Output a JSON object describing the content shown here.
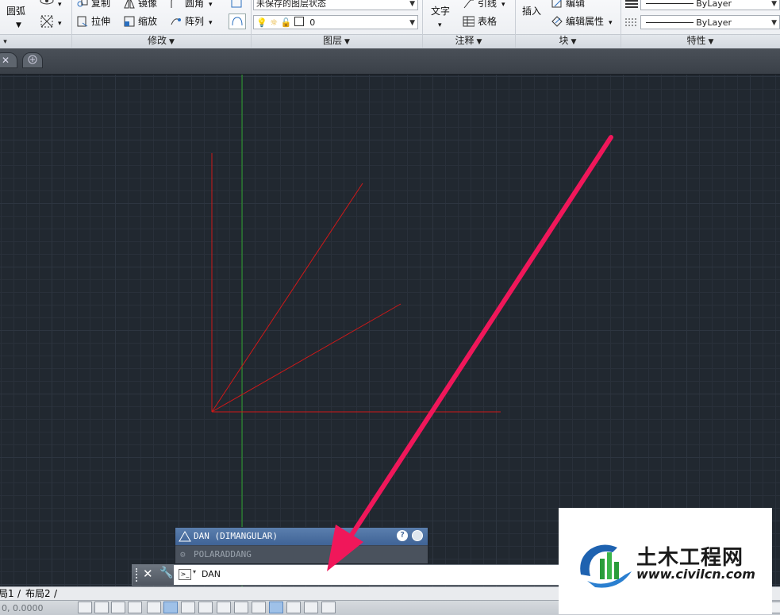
{
  "ribbon": {
    "draw": {
      "arc_label": "圆弧"
    },
    "modify": {
      "copy": "复制",
      "mirror": "镜像",
      "fillet": "圆角",
      "stretch": "拉伸",
      "scale": "缩放",
      "array": "阵列",
      "title": "修改"
    },
    "layers": {
      "state_value": "未保存的图层状态",
      "current_layer": "0",
      "title": "图层"
    },
    "annotation": {
      "text": "文字",
      "leader": "引线",
      "table": "表格",
      "title": "注释"
    },
    "block": {
      "insert": "插入",
      "edit": "编辑",
      "edit_attributes": "编辑属性",
      "title": "块"
    },
    "properties": {
      "linetype_1": "ByLayer",
      "linetype_2": "ByLayer",
      "title": "特性"
    }
  },
  "autocomplete": {
    "primary": "DAN (DIMANGULAR)",
    "secondary": "POLARADDANG"
  },
  "command_line": {
    "value": "DAN"
  },
  "layout_tabs": {
    "tab1": "局1",
    "tab2": "布局2"
  },
  "status": {
    "coords": "0, 0.0000"
  },
  "watermark": {
    "title": "土木工程网",
    "url": "www.civilcn.com"
  },
  "colors": {
    "canvas": "#212830",
    "drawing_lines": "#d01818",
    "y_axis": "#2aa02a",
    "arrow": "#f0175a",
    "autocomplete_bg": "#4a6c9e"
  }
}
